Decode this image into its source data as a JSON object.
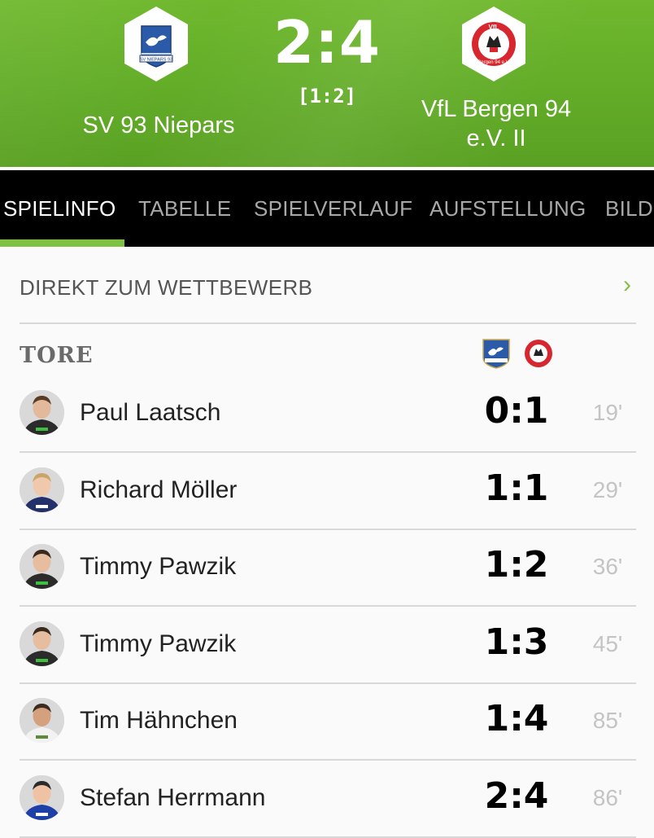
{
  "match": {
    "home_team": "SV 93 Niepars",
    "away_team_line1": "VfL Bergen 94",
    "away_team_line2": "e.V. II",
    "score": "2:4",
    "halftime": "[1:2]",
    "home_crest_text": "SV NIEPARS 93",
    "away_crest_text_top": "VfL",
    "away_crest_text_bottom": "Bergen 94 e.V."
  },
  "tabs": [
    {
      "label": "SPIELINFO",
      "active": true
    },
    {
      "label": "TABELLE",
      "active": false
    },
    {
      "label": "SPIELVERLAUF",
      "active": false
    },
    {
      "label": "AUFSTELLUNG",
      "active": false
    },
    {
      "label": "BILD",
      "active": false
    }
  ],
  "direct_link": {
    "label": "DIREKT ZUM WETTBEWERB",
    "chevron": "›"
  },
  "goals_section": {
    "title": "TORE"
  },
  "goals": [
    {
      "player": "Paul Laatsch",
      "score": "0:1",
      "minute": "19'",
      "jersey": "#2b2b2b",
      "accent": "#3fbf3f",
      "skin": "#e2b99a",
      "hair": "#5a3b24"
    },
    {
      "player": "Richard Möller",
      "score": "1:1",
      "minute": "29'",
      "jersey": "#23306a",
      "accent": "#ffffff",
      "skin": "#f0c9ad",
      "hair": "#c9a56b"
    },
    {
      "player": "Timmy Pawzik",
      "score": "1:2",
      "minute": "36'",
      "jersey": "#2b2b2b",
      "accent": "#3fbf3f",
      "skin": "#e6bd9f",
      "hair": "#3a2a1e"
    },
    {
      "player": "Timmy Pawzik",
      "score": "1:3",
      "minute": "45'",
      "jersey": "#2b2b2b",
      "accent": "#3fbf3f",
      "skin": "#e6bd9f",
      "hair": "#3a2a1e"
    },
    {
      "player": "Tim Hähnchen",
      "score": "1:4",
      "minute": "85'",
      "jersey": "#f2f2f2",
      "accent": "#5b8c3a",
      "skin": "#d4a07e",
      "hair": "#3b2c22"
    },
    {
      "player": "Stefan Herrmann",
      "score": "2:4",
      "minute": "86'",
      "jersey": "#1f3fa8",
      "accent": "#ffffff",
      "skin": "#f0c2a4",
      "hair": "#2b2b2b"
    }
  ],
  "colors": {
    "header_green": "#63ad28",
    "tab_bg": "#000000",
    "accent_green": "#7fc241",
    "away_red": "#d7262e",
    "home_blue": "#2a5aa8"
  }
}
